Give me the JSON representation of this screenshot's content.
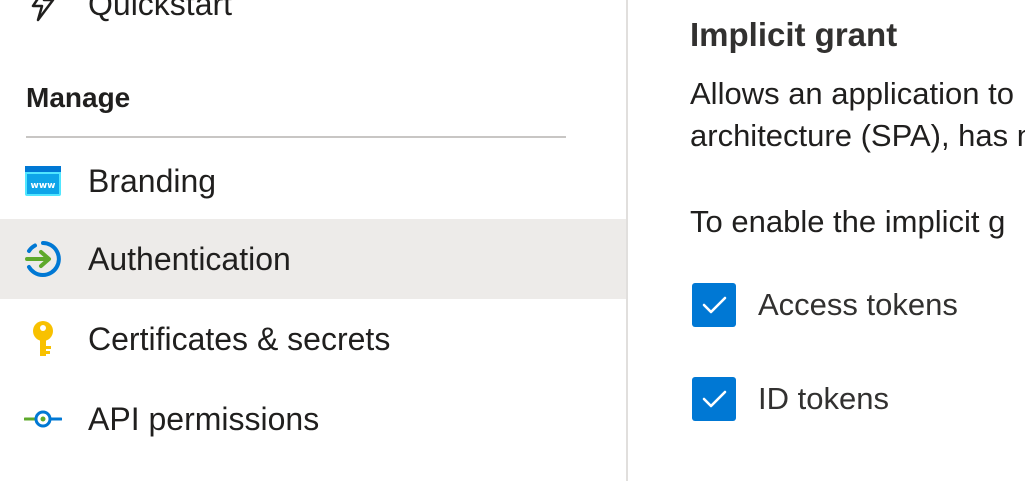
{
  "sidebar": {
    "top_item": {
      "label": "Quickstart",
      "icon": "lightning-bolt-icon"
    },
    "section_header": "Manage",
    "items": [
      {
        "label": "Branding",
        "icon": "www-window-icon",
        "active": false
      },
      {
        "label": "Authentication",
        "icon": "sign-in-arrow-icon",
        "active": true
      },
      {
        "label": "Certificates & secrets",
        "icon": "key-icon",
        "active": false
      },
      {
        "label": "API permissions",
        "icon": "api-connector-icon",
        "active": false
      }
    ]
  },
  "main": {
    "title": "Implicit grant",
    "description_lines": [
      "Allows an application to",
      "architecture (SPA), has n"
    ],
    "enable_text": "To enable the implicit g",
    "checkboxes": [
      {
        "label": "Access tokens",
        "checked": true
      },
      {
        "label": "ID tokens",
        "checked": true
      }
    ]
  },
  "colors": {
    "accent": "#0078d4",
    "active_background": "#edebe9",
    "divider": "#c8c6c4",
    "text": "#201f1e"
  }
}
